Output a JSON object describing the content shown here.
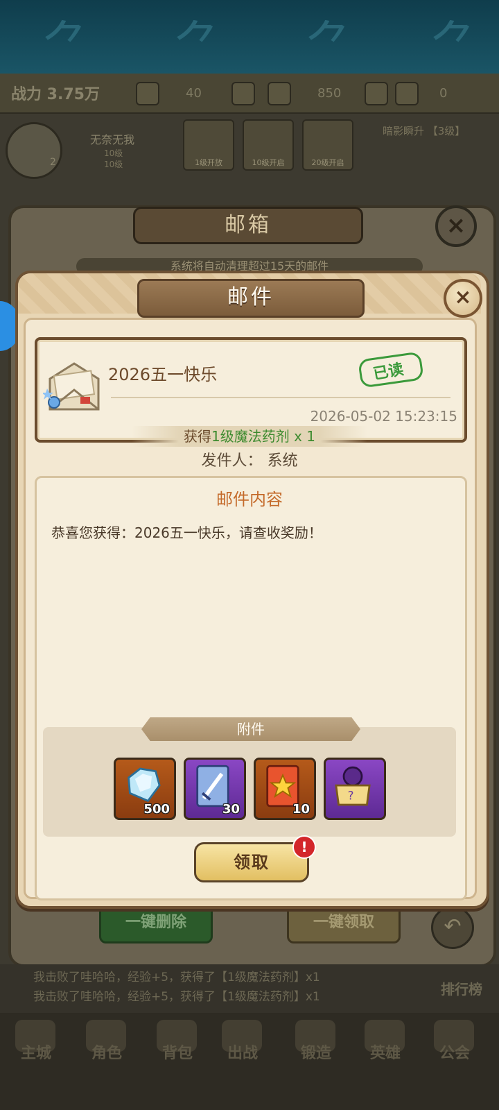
{
  "background": {
    "stat_bar": {
      "power_label": "战力 3.75万",
      "gems": "40",
      "gold": "850",
      "tickets": "0"
    },
    "player": {
      "level": "2",
      "name": "无奈无我",
      "stats": [
        "10级",
        "10级"
      ]
    },
    "slots": [
      "1级开放",
      "10级开启",
      "20级开启"
    ],
    "side_text": "暗影瞬升 【3级】"
  },
  "mailbox": {
    "title": "邮箱",
    "notice": "系统将自动清理超过15天的邮件",
    "delete_all_label": "一键删除",
    "claim_all_label": "一键领取"
  },
  "chat": {
    "lines": [
      "我击败了哇哈哈，经验+5，获得了【1级魔法药剂】x1",
      "我击败了哇哈哈，经验+5，获得了【1级魔法药剂】x1"
    ],
    "right_label": "排行榜"
  },
  "nav": {
    "items": [
      "主城",
      "角色",
      "背包",
      "出战",
      "锻造",
      "英雄",
      "公会"
    ]
  },
  "dialog": {
    "title": "邮件",
    "mail": {
      "subject": "2026五一快乐",
      "status": "已读",
      "date": "2026-05-02 15:23:15"
    },
    "gain": {
      "prefix": "获得",
      "item": "1级魔法药剂",
      "qty": " x 1"
    },
    "sender": "发件人：  系统",
    "content_title": "邮件内容",
    "content_body": "恭喜您获得：2026五一快乐，请查收奖励！",
    "attachments_label": "附件",
    "attachments": [
      {
        "icon": "diamond-icon",
        "count": "500"
      },
      {
        "icon": "sword-card-icon",
        "count": "30"
      },
      {
        "icon": "star-card-icon",
        "count": "10"
      },
      {
        "icon": "mystery-chest-icon",
        "count": ""
      }
    ],
    "claim_label": "领取",
    "claim_alert": "!"
  }
}
